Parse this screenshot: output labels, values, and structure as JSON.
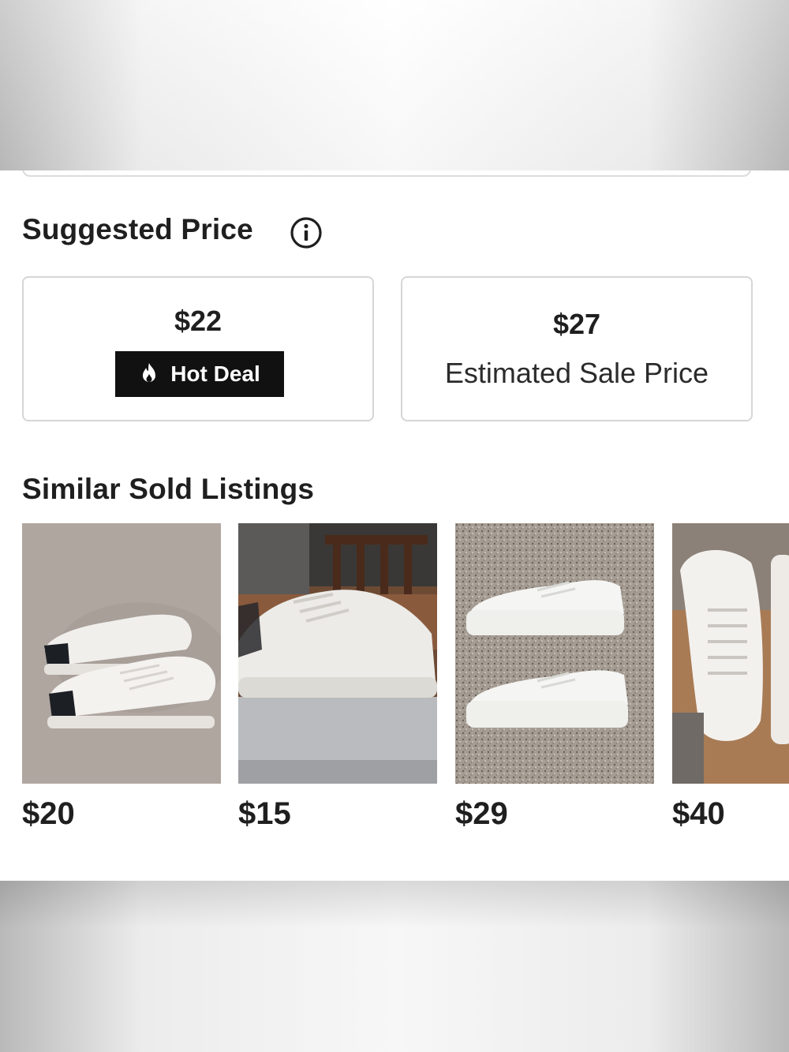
{
  "suggested_price": {
    "title": "Suggested Price",
    "info_icon": "info-circle-icon",
    "options": [
      {
        "value": "$22",
        "badge": {
          "icon": "fire-icon",
          "label": "Hot Deal"
        }
      },
      {
        "value": "$27",
        "label": "Estimated Sale Price"
      }
    ]
  },
  "similar_sold": {
    "title": "Similar Sold Listings",
    "listings": [
      {
        "price": "$20",
        "photo": "white-sneakers-with-black-heel-on-carpet"
      },
      {
        "price": "$15",
        "photo": "white-platform-sneaker-on-table"
      },
      {
        "price": "$29",
        "photo": "white-platform-sneakers-on-speckled-carpet"
      },
      {
        "price": "$40",
        "photo": "white-sneakers-in-box"
      }
    ]
  },
  "colors": {
    "badge_bg": "#111111",
    "badge_text": "#ffffff",
    "border": "#d6d6d6",
    "text": "#1f1f1f"
  }
}
